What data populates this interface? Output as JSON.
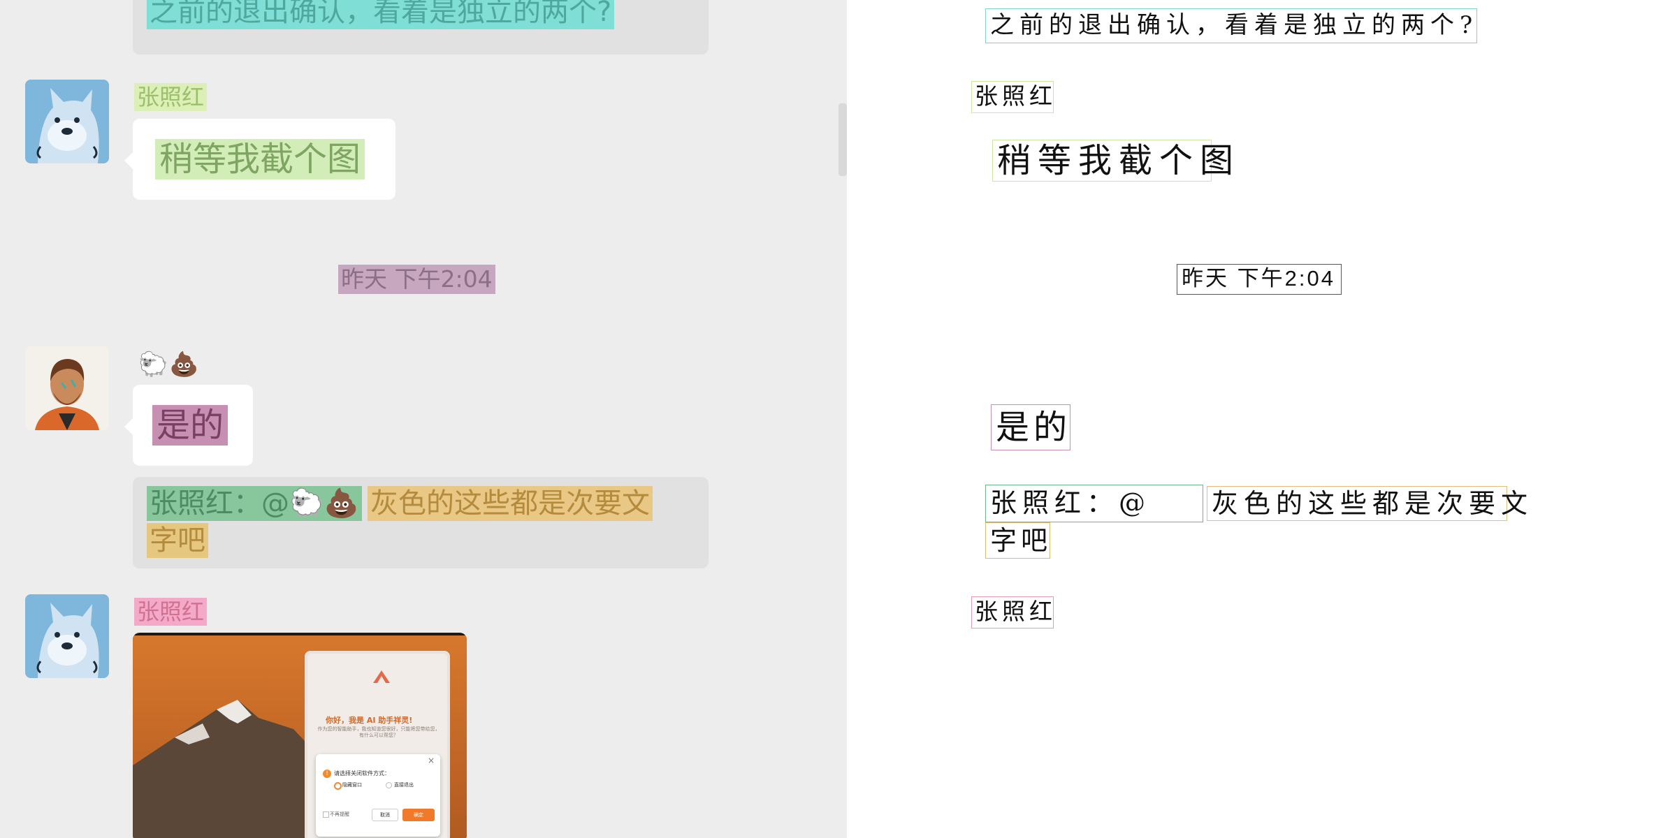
{
  "messages": [
    {
      "quote_text": "之前的退出确认，看着是独立的两个?"
    },
    {
      "sender": "张照红",
      "text": "稍等我截个图"
    },
    {
      "timestamp": "昨天 下午2:04"
    },
    {
      "sender_emoji": "🐑💩",
      "text": "是的",
      "quote_prefix": "张照红：@",
      "quote_emoji": "🐑💩",
      "quote_text_line1": "灰色的这些都是次要文",
      "quote_text_line2": "字吧"
    },
    {
      "sender": "张照红",
      "image_dialog": {
        "title": "你好，我是 AI 助手祥灵!",
        "subtitle": "作为您的智能助手，我也知道您很好，只能将您带给您，有什么可以帮您？",
        "modal_title": "请选择关闭软件方式：",
        "option_1": "隐藏窗口",
        "option_2": "直接退出",
        "checkbox": "不再提醒",
        "cancel": "取消",
        "confirm": "确定"
      }
    }
  ],
  "annotations": [
    {
      "text": "之前的退出确认，看着是独立的两个?",
      "color": "#7fd3d3"
    },
    {
      "text": "张照红",
      "color": "#cfe6a0"
    },
    {
      "text": "稍等我截个图",
      "color": "#cfe6a0"
    },
    {
      "text": "昨天 下午2:04",
      "color": "#555555"
    },
    {
      "text": "是的",
      "color": "#c48fb0"
    },
    {
      "text": "张照红：@",
      "color": "#6fb58a"
    },
    {
      "text": "灰色的这些都是次要文",
      "color": "#e0c07a"
    },
    {
      "text": "字吧",
      "color": "#d8c070"
    },
    {
      "text": "张照红",
      "color": "#e79ab8"
    }
  ]
}
